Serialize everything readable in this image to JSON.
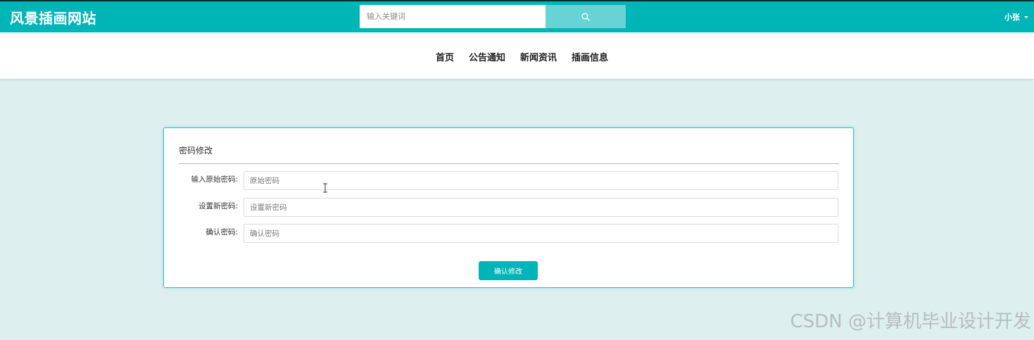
{
  "header": {
    "logo": "风景插画网站",
    "search": {
      "placeholder": "输入关键词",
      "value": ""
    },
    "search_icon": "search-icon",
    "user_name": "小张",
    "colors": {
      "primary": "#00b5b8",
      "search_button": "#66d3d4"
    }
  },
  "nav": {
    "items": [
      "首页",
      "公告通知",
      "新闻资讯",
      "插画信息"
    ]
  },
  "form": {
    "title": "密码修改",
    "fields": [
      {
        "label": "输入原始密码:",
        "placeholder": "原始密码",
        "value": ""
      },
      {
        "label": "设置新密码:",
        "placeholder": "设置新密码",
        "value": ""
      },
      {
        "label": "确认密码:",
        "placeholder": "确认密码",
        "value": ""
      }
    ],
    "submit_label": "确认修改"
  },
  "watermark": "CSDN @计算机毕业设计开发"
}
